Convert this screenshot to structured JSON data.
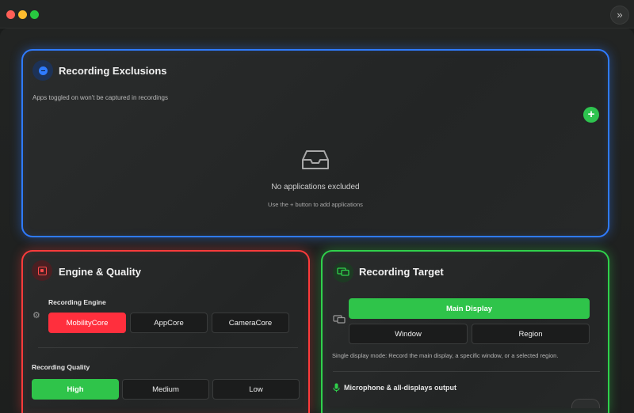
{
  "window": {
    "expand_icon": "chevrons-right-icon",
    "expand_glyph": "»"
  },
  "exclusions": {
    "title": "Recording Exclusions",
    "subtitle": "Apps toggled on won't be captured in recordings",
    "add_glyph": "+",
    "empty_title": "No applications excluded",
    "empty_hint": "Use the + button to add applications",
    "accent": "#2f7bff"
  },
  "engine": {
    "title": "Engine & Quality",
    "accent": "#ff3b3b",
    "engine_label": "Recording Engine",
    "engine_options": [
      "MobilityCore",
      "AppCore",
      "CameraCore"
    ],
    "engine_selected": "MobilityCore",
    "quality_label": "Recording Quality",
    "quality_options": [
      "High",
      "Medium",
      "Low"
    ],
    "quality_selected": "High"
  },
  "target": {
    "title": "Recording Target",
    "accent": "#2fd14b",
    "options": [
      "Main Display",
      "Window",
      "Region"
    ],
    "selected": "Main Display",
    "mode_note": "Single display mode: Record the main display, a specific window, or a selected region.",
    "audio_label": "Microphone & all-displays output"
  }
}
